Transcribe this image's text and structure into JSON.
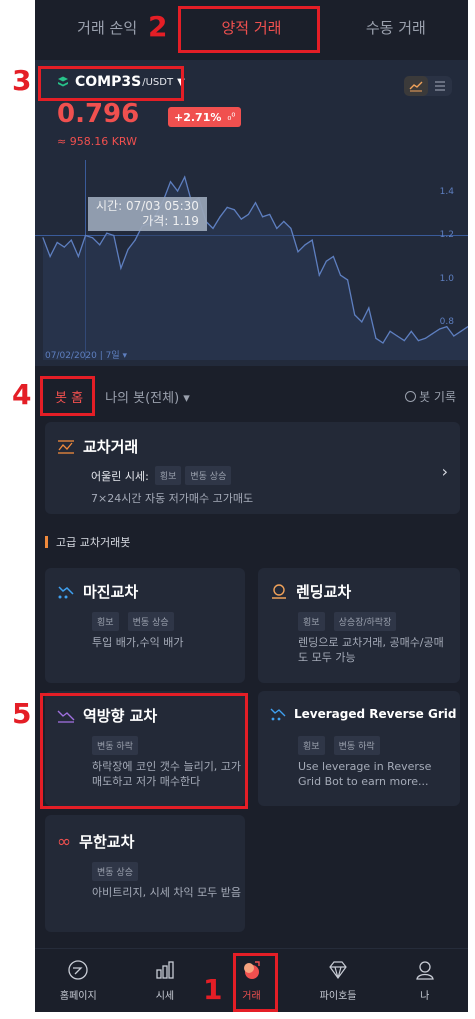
{
  "tabs": [
    {
      "label": "거래 손익",
      "active": false
    },
    {
      "label": "양적 거래",
      "active": true
    },
    {
      "label": "수동 거래",
      "active": false
    }
  ],
  "pair": {
    "base": "COMP3S",
    "quote": "/USDT",
    "caret": "▼"
  },
  "view_toggle": {
    "chart_icon": "line-chart-icon",
    "list_icon": "list-icon"
  },
  "price": {
    "value": "0.796",
    "change": "+2.71%",
    "change_icon": "percent-icon",
    "krw": "≈ 958.16 KRW"
  },
  "chart": {
    "tooltip_time": "시간: 07/03 05:30",
    "tooltip_price": "가격: 1.19",
    "y_labels": [
      "1.4",
      "1.2",
      "1.0",
      "0.8"
    ],
    "date_range": "07/02/2020 | 7일 ▾"
  },
  "chart_data": {
    "type": "line",
    "x": [
      0,
      1,
      2,
      3,
      4,
      5,
      6,
      7,
      8,
      9,
      10,
      11,
      12,
      13,
      14,
      15,
      16,
      17,
      18,
      19,
      20,
      21,
      22,
      23,
      24,
      25,
      26,
      27,
      28,
      29,
      30,
      31,
      32,
      33,
      34,
      35,
      36,
      37,
      38,
      39,
      40,
      41,
      42,
      43,
      44,
      45,
      46,
      47,
      48,
      49,
      50,
      51,
      52,
      53,
      54,
      55,
      56,
      57,
      58,
      59,
      60
    ],
    "values": [
      1.18,
      1.1,
      1.16,
      1.14,
      1.17,
      1.1,
      1.19,
      1.18,
      1.15,
      1.2,
      1.19,
      1.05,
      1.13,
      1.17,
      1.23,
      1.24,
      1.28,
      1.34,
      1.42,
      1.38,
      1.44,
      1.33,
      1.35,
      1.25,
      1.22,
      1.27,
      1.31,
      1.3,
      1.26,
      1.28,
      1.33,
      1.27,
      1.28,
      1.22,
      1.25,
      1.22,
      1.12,
      1.15,
      1.17,
      1.02,
      1.08,
      1.1,
      1.02,
      1.0,
      0.85,
      0.82,
      0.88,
      0.75,
      0.73,
      0.78,
      0.76,
      0.74,
      0.78,
      0.74,
      0.75,
      0.77,
      0.79,
      0.8,
      0.76,
      0.78,
      0.8
    ],
    "ylim": [
      0.7,
      1.47
    ],
    "yticks": [
      "1.4",
      "1.2",
      "1.0",
      "0.8"
    ]
  },
  "bot_filter": {
    "home": "봇 홈",
    "mine": "나의 봇(전체) ▾",
    "records": "봇 기록"
  },
  "featured": {
    "title": "교차거래",
    "market_label": "어울린 시세:",
    "tags": [
      "횡보",
      "변동 상승"
    ],
    "desc": "7×24시간 자동 저가매수 고가매도"
  },
  "section": {
    "label": "고급 교차거래봇"
  },
  "cards": [
    {
      "title": "마진교차",
      "tags": [
        "횡보",
        "변동 상승"
      ],
      "desc": "투입 배가,수익 배가"
    },
    {
      "title": "렌딩교차",
      "tags": [
        "횡보",
        "상승장/하락장"
      ],
      "desc": "렌딩으로 교차거래, 공매수/공매도 모두 가능"
    },
    {
      "title": "역방향 교차",
      "tags": [
        "변동 하락"
      ],
      "desc": "하락장에 코인 갯수 늘리기, 고가 매도하고 저가 매수한다"
    },
    {
      "title": "Leveraged Reverse Grid",
      "tags": [
        "횡보",
        "변동 하락"
      ],
      "desc": "Use leverage in Reverse Grid Bot to earn more..."
    },
    {
      "title": "무한교차",
      "tags": [
        "변동 상승"
      ],
      "desc": "아비트리지, 시세 차익 모두 받음"
    }
  ],
  "bottom_nav": [
    {
      "label": "홈페이지",
      "icon": "home-icon",
      "active": false
    },
    {
      "label": "시세",
      "icon": "market-icon",
      "active": false
    },
    {
      "label": "거래",
      "icon": "trade-icon",
      "active": true
    },
    {
      "label": "파이호들",
      "icon": "diamond-icon",
      "active": false
    },
    {
      "label": "나",
      "icon": "profile-icon",
      "active": false
    }
  ],
  "annotations": {
    "n1": "1",
    "n2": "2",
    "n3": "3",
    "n4": "4",
    "n5": "5"
  },
  "colors": {
    "accent": "#f0504f",
    "background": "#1b1f2a",
    "card": "#232937",
    "chart_line": "#5e7fc0",
    "annotation": "#e41e26"
  }
}
